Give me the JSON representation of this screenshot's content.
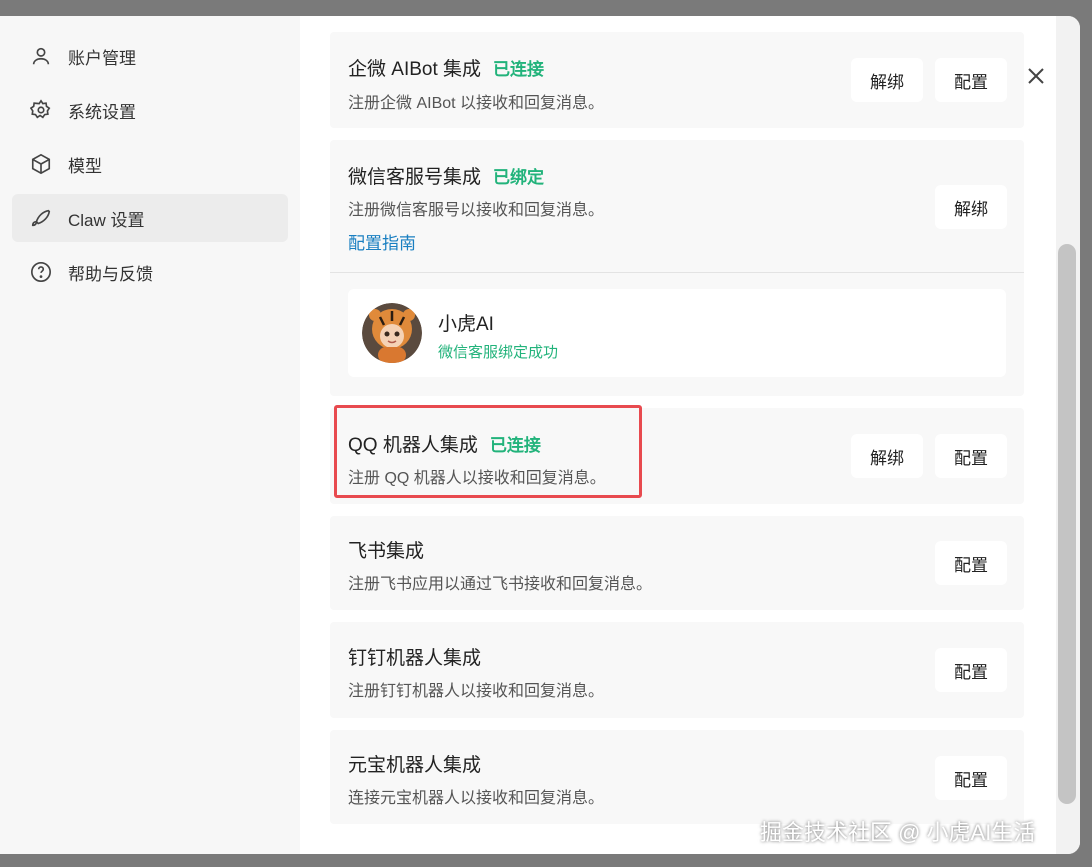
{
  "sidebar": {
    "items": [
      {
        "label": "账户管理",
        "icon": "user-icon"
      },
      {
        "label": "系统设置",
        "icon": "gear-icon"
      },
      {
        "label": "模型",
        "icon": "cube-icon"
      },
      {
        "label": "Claw 设置",
        "icon": "claw-icon",
        "active": true
      },
      {
        "label": "帮助与反馈",
        "icon": "help-icon"
      }
    ]
  },
  "integrations": [
    {
      "title": "企微 AIBot 集成",
      "status": "已连接",
      "desc": "注册企微 AIBot 以接收和回复消息。",
      "buttons": [
        "解绑",
        "配置"
      ]
    },
    {
      "title": "微信客服号集成",
      "status": "已绑定",
      "desc": "注册微信客服号以接收和回复消息。",
      "link": "配置指南",
      "buttons": [
        "解绑"
      ],
      "bound_account": {
        "name": "小虎AI",
        "status": "微信客服绑定成功"
      }
    },
    {
      "title": "QQ 机器人集成",
      "status": "已连接",
      "desc": "注册 QQ 机器人以接收和回复消息。",
      "buttons": [
        "解绑",
        "配置"
      ]
    },
    {
      "title": "飞书集成",
      "desc": "注册飞书应用以通过飞书接收和回复消息。",
      "buttons": [
        "配置"
      ]
    },
    {
      "title": "钉钉机器人集成",
      "desc": "注册钉钉机器人以接收和回复消息。",
      "buttons": [
        "配置"
      ]
    },
    {
      "title": "元宝机器人集成",
      "desc": "连接元宝机器人以接收和回复消息。",
      "buttons": [
        "配置"
      ]
    }
  ],
  "watermark": "掘金技术社区 @ 小虎AI生活",
  "colors": {
    "connected": "#22b37b",
    "link": "#1a7fc1",
    "highlight": "#e84a4f"
  }
}
